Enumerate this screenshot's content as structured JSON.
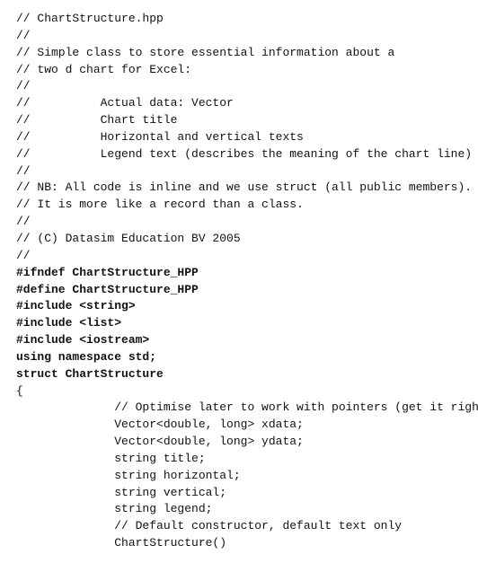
{
  "code": {
    "lines": [
      {
        "text": "// ChartStructure.hpp",
        "bold": false
      },
      {
        "text": "//",
        "bold": false
      },
      {
        "text": "// Simple class to store essential information about a",
        "bold": false
      },
      {
        "text": "// two d chart for Excel:",
        "bold": false
      },
      {
        "text": "//",
        "bold": false
      },
      {
        "text": "//          Actual data: Vector",
        "bold": false
      },
      {
        "text": "//          Chart title",
        "bold": false
      },
      {
        "text": "//          Horizontal and vertical texts",
        "bold": false
      },
      {
        "text": "//          Legend text (describes the meaning of the chart line)",
        "bold": false
      },
      {
        "text": "//",
        "bold": false
      },
      {
        "text": "// NB: All code is inline and we use struct (all public members).",
        "bold": false
      },
      {
        "text": "// It is more like a record than a class.",
        "bold": false
      },
      {
        "text": "//",
        "bold": false
      },
      {
        "text": "// (C) Datasim Education BV 2005",
        "bold": false
      },
      {
        "text": "//",
        "bold": false
      },
      {
        "text": "",
        "bold": false
      },
      {
        "text": "#ifndef ChartStructure_HPP",
        "bold": true
      },
      {
        "text": "#define ChartStructure_HPP",
        "bold": true
      },
      {
        "text": "",
        "bold": false
      },
      {
        "text": "#include <string>",
        "bold": true
      },
      {
        "text": "#include <list>",
        "bold": true
      },
      {
        "text": "#include <iostream>",
        "bold": true
      },
      {
        "text": "using namespace std;",
        "bold": true
      },
      {
        "text": "struct ChartStructure",
        "bold": true
      },
      {
        "text": "{",
        "bold": false
      },
      {
        "text": "              // Optimise later to work with pointers (get it right)",
        "bold": false
      },
      {
        "text": "              Vector<double, long> xdata;",
        "bold": false
      },
      {
        "text": "              Vector<double, long> ydata;",
        "bold": false
      },
      {
        "text": "",
        "bold": false
      },
      {
        "text": "              string title;",
        "bold": false
      },
      {
        "text": "              string horizontal;",
        "bold": false
      },
      {
        "text": "              string vertical;",
        "bold": false
      },
      {
        "text": "              string legend;",
        "bold": false
      },
      {
        "text": "",
        "bold": false
      },
      {
        "text": "              // Default constructor, default text only",
        "bold": false
      },
      {
        "text": "              ChartStructure()",
        "bold": false
      }
    ]
  }
}
